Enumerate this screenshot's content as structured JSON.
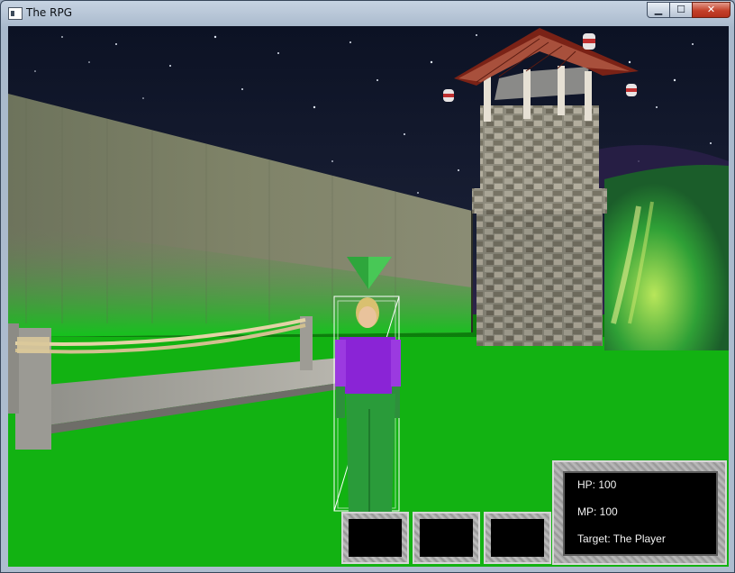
{
  "window": {
    "title": "The RPG",
    "controls": {
      "minimize": "▁",
      "maximize": "☐",
      "close": "✕"
    }
  },
  "scene": {
    "sky": "starfield",
    "ground_color": "#10b010",
    "icons": [
      "tower",
      "wall",
      "bridge",
      "player-character",
      "target-marker",
      "waterfall"
    ]
  },
  "hud": {
    "hp_label": "HP: 100",
    "mp_label": "MP: 100",
    "target_label": "Target: The Player"
  },
  "action_bar": {
    "slot_count": 3
  }
}
